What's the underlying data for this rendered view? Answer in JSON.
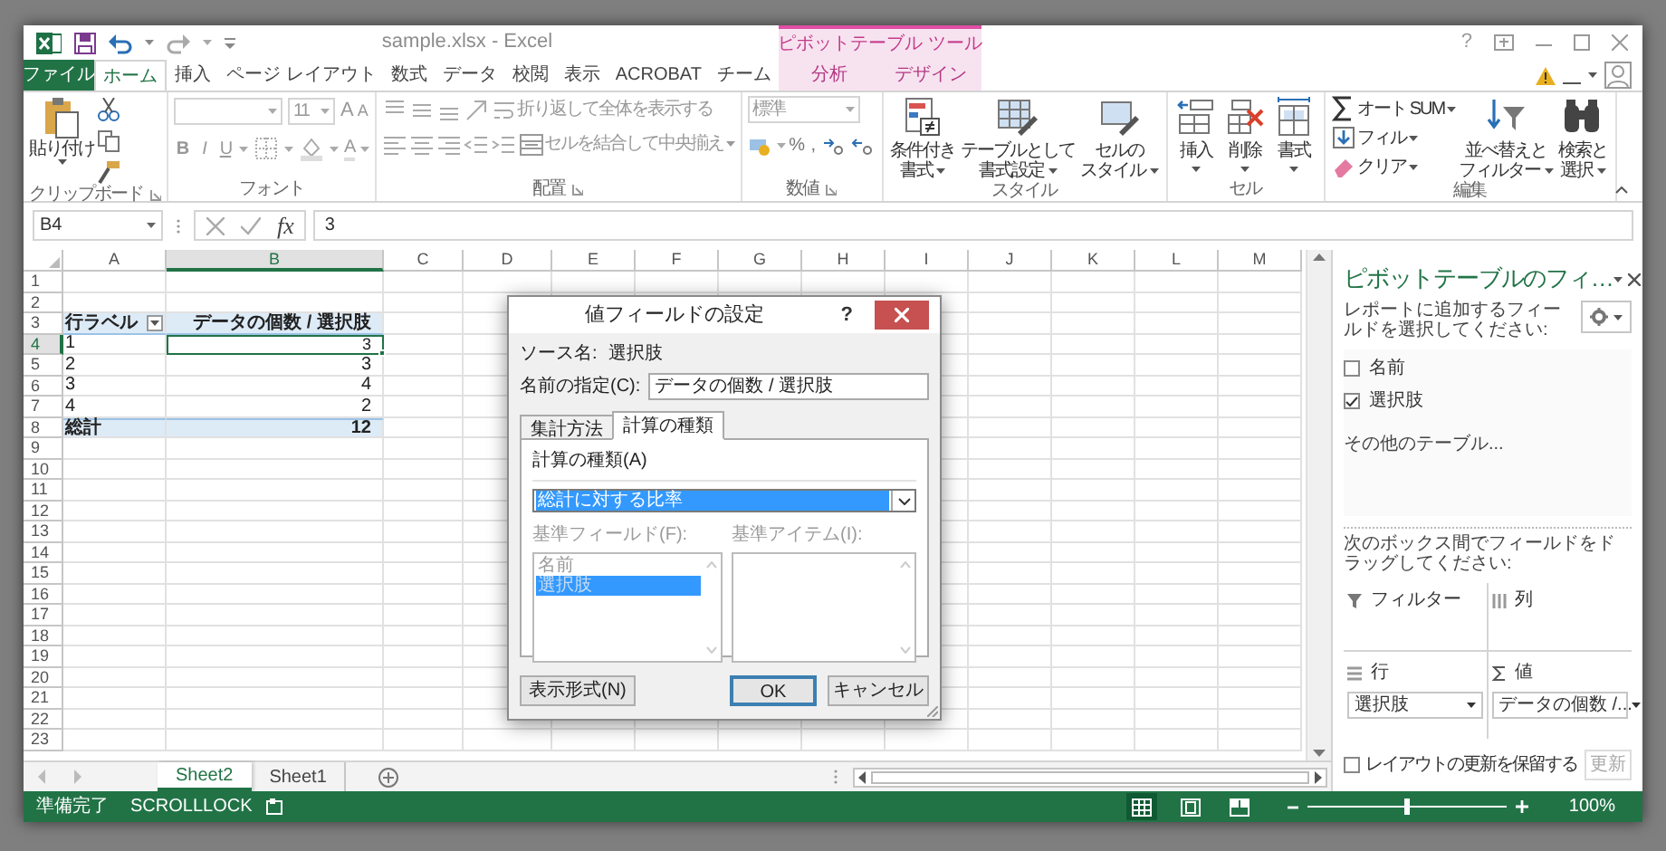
{
  "window": {
    "title": "sample.xlsx - Excel",
    "context_group": "ピボットテーブル ツール",
    "help": "?"
  },
  "tabs": [
    {
      "label": "ファイル",
      "kind": "file",
      "selected": false
    },
    {
      "label": "ホーム",
      "kind": "normal",
      "selected": true
    },
    {
      "label": "挿入",
      "kind": "normal",
      "selected": false
    },
    {
      "label": "ページ レイアウト",
      "kind": "normal",
      "selected": false
    },
    {
      "label": "数式",
      "kind": "normal",
      "selected": false
    },
    {
      "label": "データ",
      "kind": "normal",
      "selected": false
    },
    {
      "label": "校閲",
      "kind": "normal",
      "selected": false
    },
    {
      "label": "表示",
      "kind": "normal",
      "selected": false
    },
    {
      "label": "ACROBAT",
      "kind": "normal",
      "selected": false
    },
    {
      "label": "チーム",
      "kind": "normal",
      "selected": false
    },
    {
      "label": "分析",
      "kind": "context",
      "selected": false
    },
    {
      "label": "デザイン",
      "kind": "context",
      "selected": false
    }
  ],
  "ribbon": [
    {
      "kind": "clipboard",
      "label": "クリップボード",
      "paste": "貼り付け"
    },
    {
      "kind": "font",
      "label": "フォント",
      "font_size": "11",
      "grow": "A",
      "shrink": "A",
      "styles": [
        "B",
        "I",
        "U"
      ],
      "font_color": "A"
    },
    {
      "kind": "alignment",
      "label": "配置",
      "wrap": "折り返して全体を表示する",
      "merge": "セルを結合して中央揃え"
    },
    {
      "kind": "number",
      "label": "数値",
      "format": "標準",
      "percent": "%",
      "comma": ","
    },
    {
      "kind": "large",
      "label": "スタイル",
      "buttons": [
        {
          "kind": "conditional",
          "lines": [
            "条件付き",
            "書式"
          ]
        },
        {
          "kind": "table",
          "lines": [
            "テーブルとして",
            "書式設定"
          ]
        },
        {
          "kind": "cell_style",
          "lines": [
            "セルの",
            "スタイル"
          ]
        }
      ]
    },
    {
      "kind": "large",
      "label": "セル",
      "buttons": [
        {
          "kind": "insert",
          "lines": [
            "挿入"
          ]
        },
        {
          "kind": "delete",
          "lines": [
            "削除"
          ]
        },
        {
          "kind": "format",
          "lines": [
            "書式"
          ]
        }
      ]
    },
    {
      "kind": "editing",
      "label": "編集",
      "small": [
        {
          "kind": "sum",
          "label": "オート SUM"
        },
        {
          "kind": "fill",
          "label": "フィル"
        },
        {
          "kind": "clear",
          "label": "クリア"
        }
      ],
      "buttons": [
        {
          "kind": "sort",
          "lines": [
            "並べ替えと",
            "フィルター"
          ]
        },
        {
          "kind": "find",
          "lines": [
            "検索と",
            "選択"
          ]
        }
      ]
    }
  ],
  "formula_bar": {
    "name_box": "B4",
    "function_button": "fx",
    "value": "3"
  },
  "sheet": {
    "columns": [
      {
        "label": "A",
        "selected": false
      },
      {
        "label": "B",
        "selected": true
      },
      {
        "label": "C",
        "selected": false
      },
      {
        "label": "D",
        "selected": false
      },
      {
        "label": "E",
        "selected": false
      },
      {
        "label": "F",
        "selected": false
      },
      {
        "label": "G",
        "selected": false
      },
      {
        "label": "H",
        "selected": false
      },
      {
        "label": "I",
        "selected": false
      },
      {
        "label": "J",
        "selected": false
      },
      {
        "label": "K",
        "selected": false
      },
      {
        "label": "L",
        "selected": false
      },
      {
        "label": "M",
        "selected": false
      }
    ],
    "rows": [
      {
        "header": "1",
        "selected": false
      },
      {
        "header": "2",
        "selected": false
      },
      {
        "header": "3",
        "selected": false,
        "kind": "pivot_header",
        "cells": [
          "行ラベル",
          "データの個数 / 選択肢"
        ]
      },
      {
        "header": "4",
        "selected": true,
        "kind": "item",
        "cells": [
          "1",
          "3"
        ]
      },
      {
        "header": "5",
        "selected": false,
        "kind": "item",
        "cells": [
          "2",
          "3"
        ]
      },
      {
        "header": "6",
        "selected": false,
        "kind": "item",
        "cells": [
          "3",
          "4"
        ]
      },
      {
        "header": "7",
        "selected": false,
        "kind": "item",
        "cells": [
          "4",
          "2"
        ]
      },
      {
        "header": "8",
        "selected": false,
        "kind": "total",
        "cells": [
          "総計",
          "12"
        ]
      },
      {
        "header": "9",
        "selected": false
      },
      {
        "header": "10",
        "selected": false
      },
      {
        "header": "11",
        "selected": false
      },
      {
        "header": "12",
        "selected": false
      },
      {
        "header": "13",
        "selected": false
      },
      {
        "header": "14",
        "selected": false
      },
      {
        "header": "15",
        "selected": false
      },
      {
        "header": "16",
        "selected": false
      },
      {
        "header": "17",
        "selected": false
      },
      {
        "header": "18",
        "selected": false
      },
      {
        "header": "19",
        "selected": false
      },
      {
        "header": "20",
        "selected": false
      },
      {
        "header": "21",
        "selected": false
      },
      {
        "header": "22",
        "selected": false
      },
      {
        "header": "23",
        "selected": false
      }
    ]
  },
  "sheet_tabs": [
    {
      "label": "Sheet2",
      "selected": true
    },
    {
      "label": "Sheet1",
      "selected": false
    }
  ],
  "dialog": {
    "title": "値フィールドの設定",
    "help": "?",
    "source_label": "ソース名:",
    "source_value": "選択肢",
    "name_label": "名前の指定(C):",
    "name_value": "データの個数 / 選択肢",
    "tabs": [
      {
        "label": "集計方法",
        "selected": false
      },
      {
        "label": "計算の種類",
        "selected": true
      }
    ],
    "calc_label": "計算の種類(A)",
    "calc_value": "総計に対する比率",
    "base_field_label": "基準フィールド(F):",
    "base_fields": [
      {
        "label": "名前",
        "selected": false
      },
      {
        "label": "選択肢",
        "selected": true
      }
    ],
    "base_item_label": "基準アイテム(I):",
    "lists_disabled": true,
    "buttons": [
      {
        "label": "表示形式(N)",
        "kind": "format"
      },
      {
        "label": "OK",
        "kind": "default"
      },
      {
        "label": "キャンセル",
        "kind": "cancel"
      }
    ]
  },
  "pivot_panel": {
    "title": "ピボットテーブルのフィ…",
    "instruction": "レポートに追加するフィールドを選択してください:",
    "fields": [
      {
        "label": "名前",
        "checked": false
      },
      {
        "label": "選択肢",
        "checked": true
      }
    ],
    "more_tables": "その他のテーブル...",
    "drag_hint": "次のボックス間でフィールドをドラッグしてください:",
    "areas": [
      {
        "label": "フィルター",
        "kind": "filter"
      },
      {
        "label": "列",
        "kind": "columns"
      },
      {
        "label": "行",
        "kind": "rows",
        "items": [
          "選択肢"
        ]
      },
      {
        "label": "値",
        "kind": "values",
        "items": [
          "データの個数 /..."
        ]
      }
    ],
    "defer_label": "レイアウトの更新を保留する",
    "defer_checked": false,
    "update_button": "更新",
    "update_disabled": true
  },
  "status_bar": {
    "ready": "準備完了",
    "scroll_lock": "SCROLLLOCK",
    "views": [
      {
        "kind": "normal",
        "selected": true
      },
      {
        "kind": "page_layout",
        "selected": false
      },
      {
        "kind": "page_break",
        "selected": false
      }
    ],
    "zoom": {
      "level": 0.5,
      "label": "100%"
    }
  }
}
